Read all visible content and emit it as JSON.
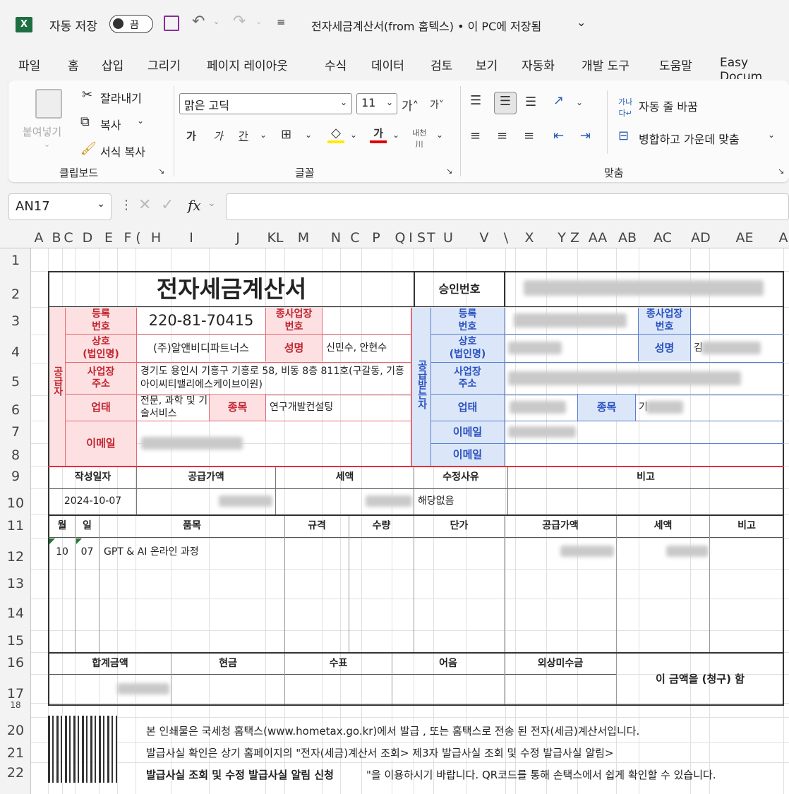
{
  "titlebar": {
    "autosave_label": "자동 저장",
    "toggle_state": "끔",
    "doc_title": "전자세금계산서(from 홈텍스) • 이 PC에 저장됨"
  },
  "menu": [
    "파일",
    "홈",
    "삽입",
    "그리기",
    "페이지 레이아웃",
    "수식",
    "데이터",
    "검토",
    "보기",
    "자동화",
    "개발 도구",
    "도움말",
    "Easy Docum"
  ],
  "ribbon": {
    "paste_label": "붙여넣기",
    "cut_label": "잘라내기",
    "copy_label": "복사",
    "format_painter_label": "서식 복사",
    "clipboard_group": "클립보드",
    "font_name": "맑은 고딕",
    "font_size": "11",
    "font_group": "글꼴",
    "wrap_text": "자동 줄 바꿈",
    "merge_center": "병합하고 가운데 맞춤",
    "align_group": "맞춤"
  },
  "formula_bar": {
    "name_box": "AN17",
    "fx": "fx",
    "formula": ""
  },
  "columns": [
    "A",
    "B",
    "C",
    "D",
    "E",
    "F",
    "(",
    "H",
    "I",
    "J",
    "KL",
    "M",
    "N",
    "C",
    "P",
    "Q",
    "I",
    "S",
    "T",
    "U",
    "V",
    "\\",
    "X",
    "Y",
    "Z",
    "AA",
    "AB",
    "AC",
    "AD",
    "AE",
    "A"
  ],
  "rows": [
    "1",
    "2",
    "3",
    "4",
    "5",
    "6",
    "7",
    "8",
    "9",
    "10",
    "11",
    "12",
    "13",
    "14",
    "15",
    "16",
    "17",
    "18",
    "20",
    "21",
    "22"
  ],
  "invoice": {
    "title": "전자세금계산서",
    "approval_label": "승인번호",
    "supplier_side": "공급자",
    "buyer_side": "공급받는자",
    "reg_no_label": "등록\n번호",
    "reg_no": "220-81-70415",
    "branch_label": "종사업장\n번호",
    "company_label": "상호\n(법인명)",
    "company": "(주)알앤비디파트너스",
    "ceo_label": "성명",
    "ceo": "신민수, 안현수",
    "address_label": "사업장\n주소",
    "address": "경기도 용인시 기흥구 기흥로 58, 비동 8층 811호(구갈동, 기흥아이씨티밸리에스케이브이원)",
    "biz_type_label": "업태",
    "biz_type": "전문, 과학 및 기술서비스",
    "item_label": "종목",
    "item": "연구개발컨설팅",
    "email_label": "이메일",
    "buyer_item_value": "기",
    "buyer_ceo_value": "김",
    "date_label": "작성일자",
    "supply_amount_label": "공급가액",
    "tax_label": "세액",
    "reason_label": "수정사유",
    "note_label": "비고",
    "date": "2024-10-07",
    "reason": "해당없음",
    "line_headers": [
      "월",
      "일",
      "품목",
      "규격",
      "수량",
      "단가",
      "공급가액",
      "세액",
      "비고"
    ],
    "line_items": [
      {
        "month": "10",
        "day": "07",
        "name": "GPT & AI 온라인 과정"
      }
    ],
    "total_label": "합계금액",
    "cash_label": "현금",
    "check_label": "수표",
    "note_bill_label": "어음",
    "credit_label": "외상미수금",
    "claim_text": "이 금액을 (청구) 함",
    "footer_line1": "본 인쇄물은 국세청 홈택스(www.hometax.go.kr)에서   발급 , 또는 홈택스로 전송 된 전자(세금)계산서입니다.",
    "footer_line2": "발급사실 확인은 상기 홈페이지의 \"전자(세금)계산서 조회> 제3자 발급사실 조회 및 수정 발급사실 알림>",
    "footer_line3a": "발급사실 조회 및 수정 발급사실 알림 신청",
    "footer_line3b": "\"을 이용하시기 바랍니다. QR코드를 통해 손택스에서 쉽게 확인할 수 있습니다."
  },
  "colors": {
    "red_label": "#c0242e",
    "blue_label": "#2a50c0",
    "red_bg": "#fde0e2",
    "blue_bg": "#dbe7f8",
    "excel_green": "#217346"
  }
}
